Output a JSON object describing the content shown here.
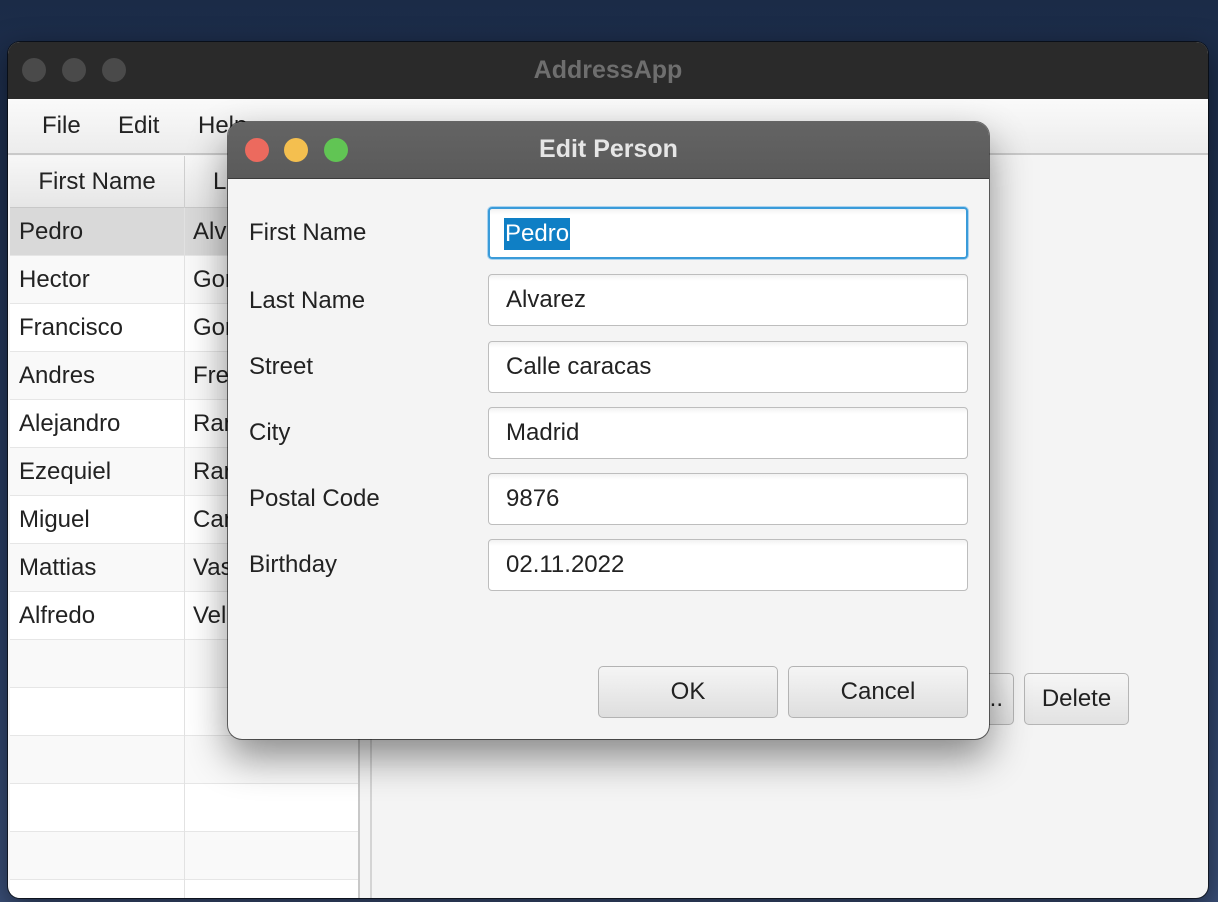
{
  "main_window": {
    "title": "AddressApp",
    "menu": [
      "File",
      "Edit",
      "Help"
    ],
    "table": {
      "headers": [
        "First Name",
        "L"
      ],
      "rows": [
        {
          "first": "Pedro",
          "last": "Alv"
        },
        {
          "first": "Hector",
          "last": "Gor"
        },
        {
          "first": "Francisco",
          "last": "Gor"
        },
        {
          "first": "Andres",
          "last": "Fre"
        },
        {
          "first": "Alejandro",
          "last": "Rar"
        },
        {
          "first": "Ezequiel",
          "last": "Rar"
        },
        {
          "first": "Miguel",
          "last": "Car"
        },
        {
          "first": "Mattias",
          "last": "Vas"
        },
        {
          "first": "Alfredo",
          "last": "Vel"
        }
      ],
      "selected_row": 0
    },
    "buttons": {
      "edit_partial": "...",
      "delete": "Delete"
    }
  },
  "dialog": {
    "title": "Edit Person",
    "fields": [
      {
        "label": "First Name",
        "value": "Pedro"
      },
      {
        "label": "Last Name",
        "value": "Alvarez"
      },
      {
        "label": "Street",
        "value": "Calle caracas"
      },
      {
        "label": "City",
        "value": "Madrid"
      },
      {
        "label": "Postal Code",
        "value": "9876"
      },
      {
        "label": "Birthday",
        "value": "02.11.2022"
      }
    ],
    "ok_label": "OK",
    "cancel_label": "Cancel"
  },
  "colors": {
    "traffic_close": "#ec6a5e",
    "traffic_min": "#f4bf4f",
    "traffic_max": "#61c554",
    "focus_ring": "#3a9bd9",
    "selection": "#0f7fc5"
  }
}
